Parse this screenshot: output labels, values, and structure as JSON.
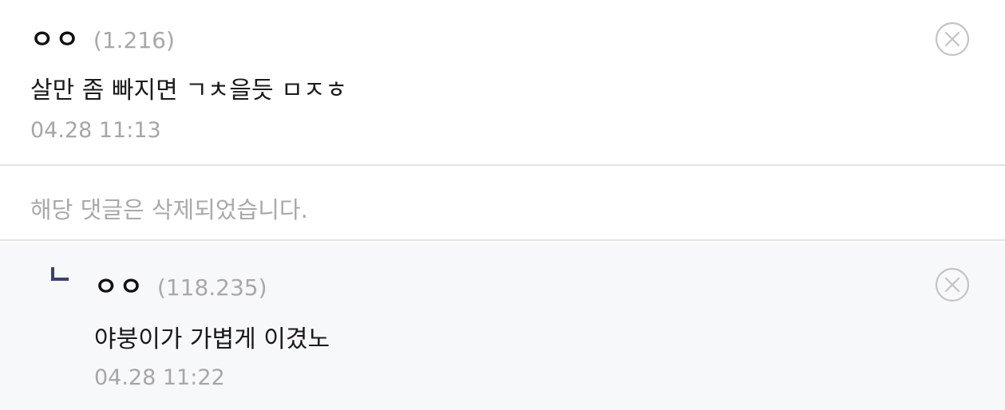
{
  "comments": [
    {
      "nickname": "ㅇㅇ",
      "ip": "(1.216)",
      "text": "살만 좀 빠지면 ㄱㅊ을듯 ㅁㅈㅎ",
      "date": "04.28 11:13",
      "delete_icon": "circle-x-icon"
    },
    {
      "deleted_text": "해당 댓글은 삭제되었습니다."
    },
    {
      "reply_icon": "reply-arrow-icon",
      "nickname": "ㅇㅇ",
      "ip": "(118.235)",
      "text": "야붕이가 가볍게 이겼노",
      "date": "04.28 11:22",
      "delete_icon": "circle-x-icon"
    }
  ],
  "colors": {
    "reply_background": "#f7f8fa",
    "reply_mark": "#3b3f73",
    "divider": "#e3e3e3",
    "meta_text": "#a8a8a8"
  }
}
